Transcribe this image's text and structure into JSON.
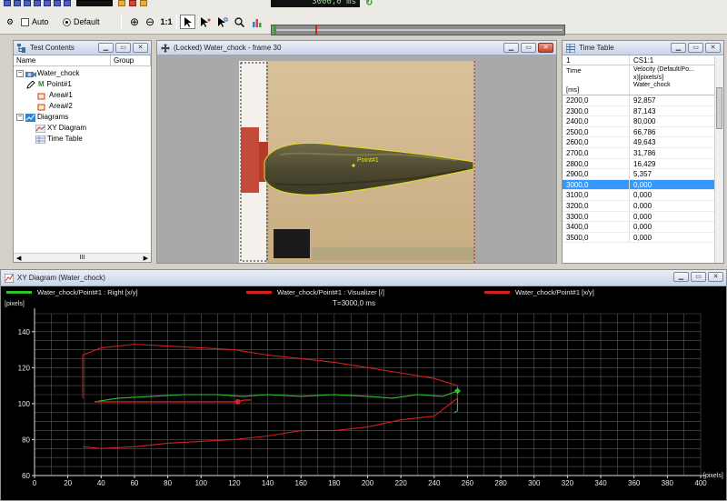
{
  "toolbar": {
    "lcd_time": "3000,0 ms",
    "auto_label": "Auto",
    "default_label": "Default",
    "zoom_in_label": "⊕",
    "zoom_out_label": "⊖",
    "zoom_11_label": "1:1",
    "timeline_progress": 0.15
  },
  "test_contents": {
    "title": "Test Contents",
    "col_name": "Name",
    "col_group": "Group",
    "root": "Water_chock",
    "point": "Point#1",
    "area1": "Area#1",
    "area2": "Area#2",
    "diagrams": "Diagrams",
    "xy_diagram": "XY Diagram",
    "time_table": "Time Table",
    "scroll_left": "◀",
    "scroll_mid": "III",
    "scroll_right": "▶"
  },
  "image_view": {
    "title": "(Locked) Water_chock - frame 30",
    "point_label": "Point#1"
  },
  "time_table": {
    "title": "Time Table",
    "head_index": "1",
    "head_cs": "CS1:1",
    "col_time": "Time",
    "col_velocity_1": "Velocity (Default/Po...",
    "col_velocity_2": "x)[pixels/s]",
    "col_unit": "[ms]",
    "col_source": "Water_chock",
    "rows": [
      {
        "t": "2200,0",
        "v": "92,857"
      },
      {
        "t": "2300,0",
        "v": "87,143"
      },
      {
        "t": "2400,0",
        "v": "80,000"
      },
      {
        "t": "2500,0",
        "v": "66,786"
      },
      {
        "t": "2600,0",
        "v": "49,643"
      },
      {
        "t": "2700,0",
        "v": "31,786"
      },
      {
        "t": "2800,0",
        "v": "16,429"
      },
      {
        "t": "2900,0",
        "v": "5,357"
      },
      {
        "t": "3000,0",
        "v": "0,000"
      },
      {
        "t": "3100,0",
        "v": "0,000"
      },
      {
        "t": "3200,0",
        "v": "0,000"
      },
      {
        "t": "3300,0",
        "v": "0,000"
      },
      {
        "t": "3400,0",
        "v": "0,000"
      },
      {
        "t": "3500,0",
        "v": "0,000"
      }
    ],
    "selected_index": 8
  },
  "xy_diagram": {
    "title": "XY Diagram (Water_chock)",
    "legend": [
      {
        "label": "Water_chock/Point#1 : Right [x/y]",
        "color": "#2ec42e"
      },
      {
        "label": "Water_chock/Point#1 : Visualizer [/]",
        "color": "#d42020"
      },
      {
        "label": "Water_chock/Point#1 [x/y]",
        "color": "#d42020"
      }
    ]
  },
  "chart_data": {
    "type": "line",
    "title": "T=3000,0 ms",
    "ylabel": "[pixels]",
    "xlabel": "[pixels]",
    "xlim": [
      0,
      400
    ],
    "ylim": [
      60,
      150
    ],
    "xticks": [
      0,
      20,
      40,
      60,
      80,
      100,
      120,
      140,
      160,
      180,
      200,
      220,
      240,
      260,
      280,
      300,
      320,
      340,
      360,
      380,
      400
    ],
    "yticks": [
      60,
      80,
      100,
      120,
      140
    ],
    "grid": true,
    "series": [
      {
        "name": "Water_chock/Point#1 : Right [x/y]",
        "color": "#2ec42e",
        "x": [
          36,
          50,
          70,
          90,
          110,
          125,
          140,
          160,
          180,
          200,
          215,
          230,
          245,
          254,
          254,
          252
        ],
        "y": [
          101,
          103,
          104,
          105,
          105,
          104,
          105,
          104,
          105,
          104,
          103,
          105,
          104,
          107,
          96,
          95
        ]
      },
      {
        "name": "Water_chock/Point#1 : Visualizer [/]",
        "color": "#d42020",
        "x": [
          29,
          29,
          40,
          60,
          80,
          100,
          120,
          140,
          160,
          180,
          200,
          220,
          240,
          254,
          254,
          240,
          220,
          200,
          180,
          160,
          140,
          120,
          100,
          80,
          60,
          40,
          29
        ],
        "y": [
          103,
          127,
          131,
          133,
          132,
          131,
          130,
          127,
          125,
          123,
          120,
          117,
          114,
          110,
          103,
          93,
          91,
          87,
          85,
          85,
          82,
          80,
          79,
          78,
          76,
          75,
          76
        ]
      },
      {
        "name": "Water_chock/Point#1 [x/y]",
        "color": "#d42020",
        "x": [
          36,
          60,
          90,
          110,
          118,
          122,
          126,
          130
        ],
        "y": [
          101,
          101,
          101,
          101,
          101,
          101,
          102,
          102
        ]
      }
    ],
    "markers": [
      {
        "x": 254,
        "y": 107,
        "color": "#2ec42e"
      },
      {
        "x": 122,
        "y": 101,
        "color": "#e02020"
      }
    ]
  }
}
